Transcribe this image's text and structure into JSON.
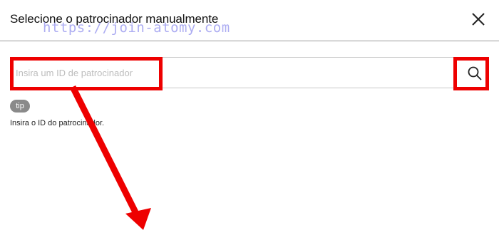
{
  "dialog": {
    "title": "Selecione o patrocinador manualmente",
    "watermark": "https://join-atomy.com",
    "close_icon": "close-icon"
  },
  "search": {
    "placeholder": "Insira um ID de patrocinador",
    "value": "",
    "button_icon": "search-icon"
  },
  "tip": {
    "badge": "tip",
    "text": "Insira o ID do patrocinador."
  },
  "colors": {
    "annotation": "#ee0000",
    "tip_badge": "#8a8a8a"
  }
}
